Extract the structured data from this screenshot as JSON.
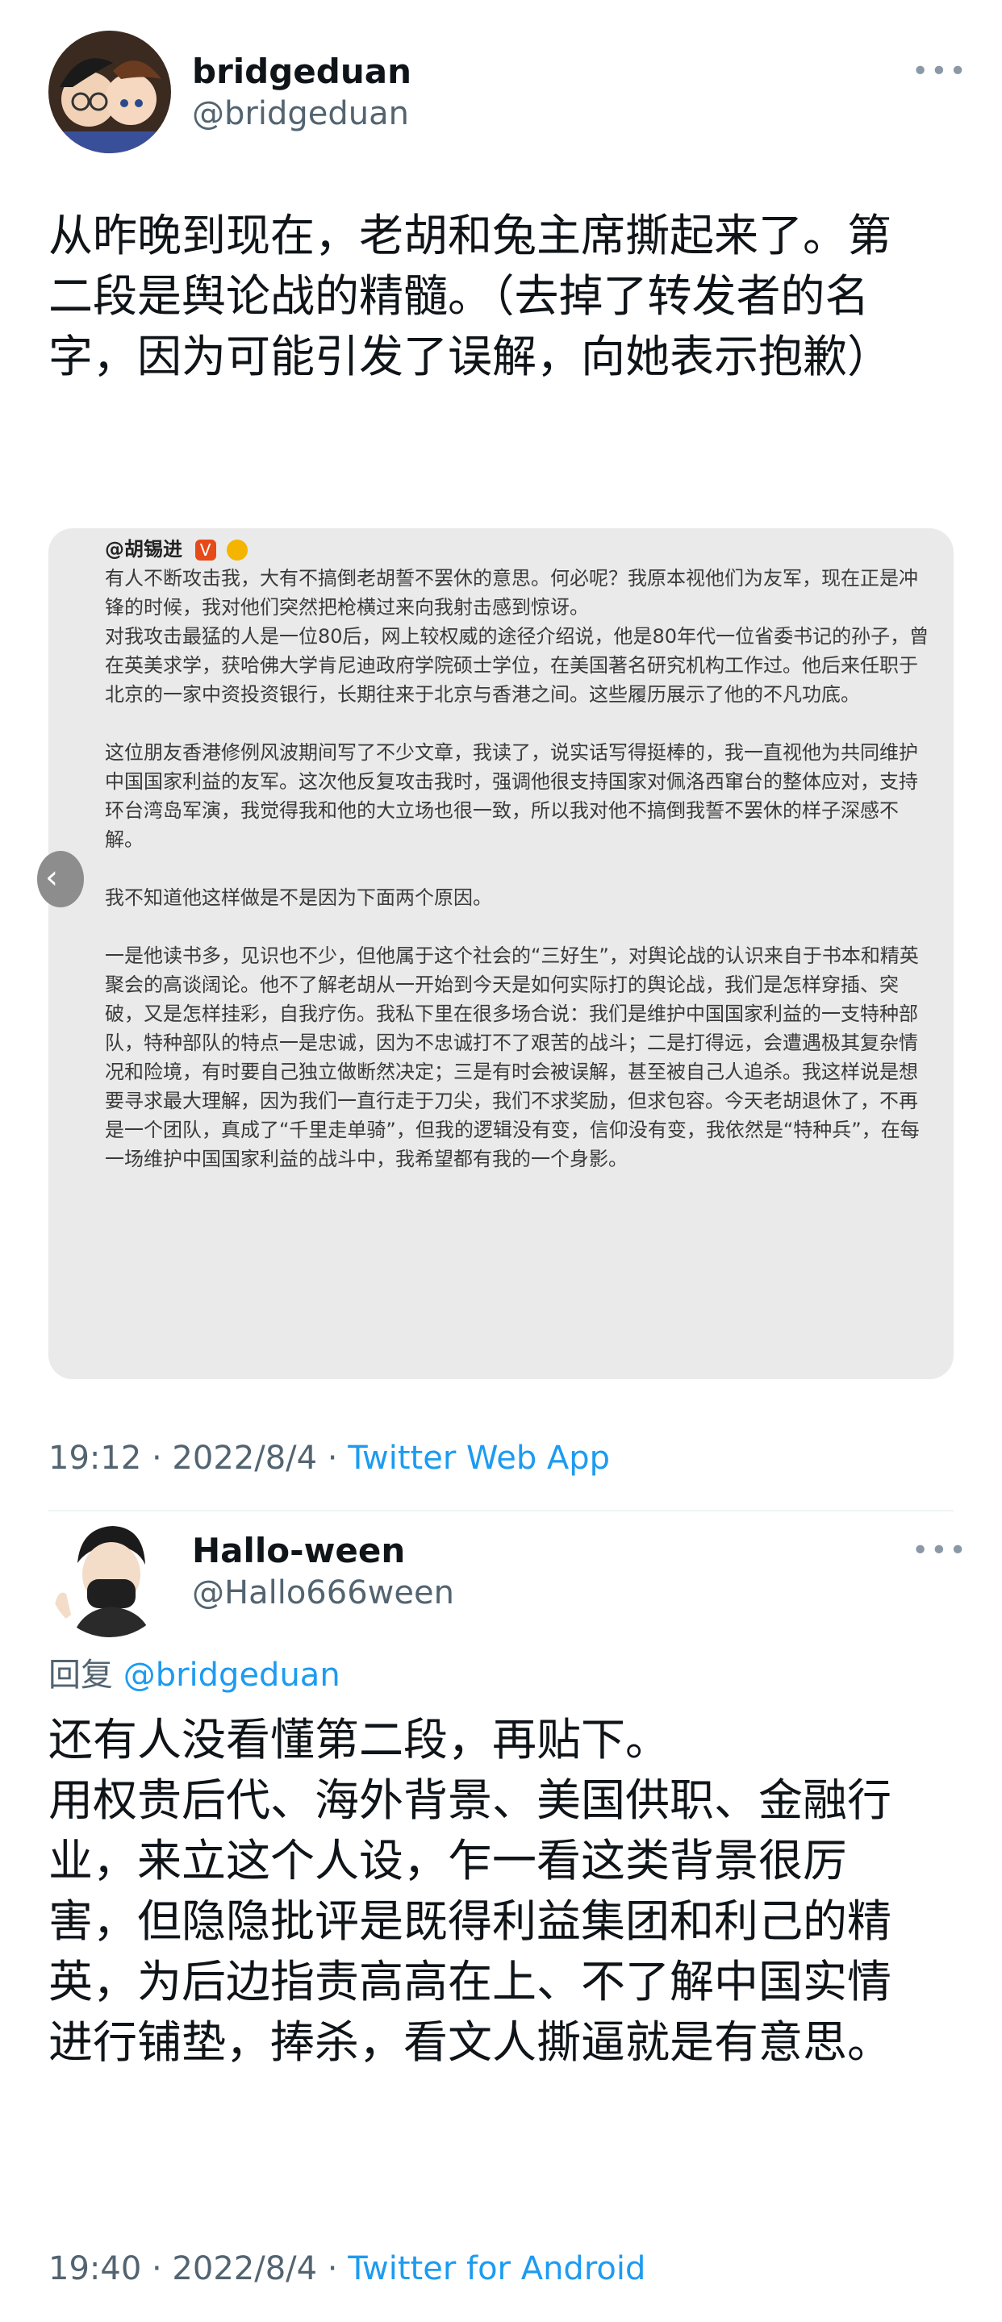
{
  "tweet1": {
    "author_name": "bridgeduan",
    "author_handle": "@bridgeduan",
    "more_icon": "more-horizontal-icon",
    "text": "从昨晚到现在，老胡和兔主席撕起来了。第二段是舆论战的精髓。（去掉了转发者的名字，因为可能引发了误解，向她表示抱歉）",
    "timestamp": "19:12 · 2022/8/4 · ",
    "source": "Twitter Web App",
    "embedded_image": {
      "header": "@胡锡进",
      "badge": "V",
      "paragraphs": [
        "有人不断攻击我，大有不搞倒老胡誓不罢休的意思。何必呢？我原本视他们为友军，现在正是冲锋的时候，我对他们突然把枪横过来向我射击感到惊讶。",
        "对我攻击最猛的人是一位80后，网上较权威的途径介绍说，他是80年代一位省委书记的孙子，曾在英美求学，获哈佛大学肯尼迪政府学院硕士学位，在美国著名研究机构工作过。他后来任职于北京的一家中资投资银行，长期往来于北京与香港之间。这些履历展示了他的不凡功底。",
        "这位朋友香港修例风波期间写了不少文章，我读了，说实话写得挺棒的，我一直视他为共同维护中国国家利益的友军。这次他反复攻击我时，强调他很支持国家对佩洛西窜台的整体应对，支持环台湾岛军演，我觉得我和他的大立场也很一致，所以我对他不搞倒我誓不罢休的样子深感不解。",
        "我不知道他这样做是不是因为下面两个原因。",
        "一是他读书多，见识也不少，但他属于这个社会的“三好生”，对舆论战的认识来自于书本和精英聚会的高谈阔论。他不了解老胡从一开始到今天是如何实际打的舆论战，我们是怎样穿插、突破，又是怎样挂彩，自我疗伤。我私下里在很多场合说：我们是维护中国国家利益的一支特种部队，特种部队的特点一是忠诚，因为不忠诚打不了艰苦的战斗；二是打得远，会遭遇极其复杂情况和险境，有时要自己独立做断然决定；三是有时会被误解，甚至被自己人追杀。我这样说是想要寻求最大理解，因为我们一直行走于刀尖，我们不求奖励，但求包容。今天老胡退休了，不再是一个团队，真成了“千里走单骑”，但我的逻辑没有变，信仰没有变，我依然是“特种兵”，在每一场维护中国国家利益的战斗中，我希望都有我的一个身影。"
      ]
    }
  },
  "tweet2": {
    "author_name": "Hallo-ween",
    "author_handle": "@Hallo666ween",
    "more_icon": "more-horizontal-icon",
    "reply_prefix": "回复 ",
    "reply_to": "@bridgeduan",
    "text": "还有人没看懂第二段，再贴下。\n用权贵后代、海外背景、美国供职、金融行业，来立这个人设，乍一看这类背景很厉害，但隐隐批评是既得利益集团和利己的精英，为后边指责高高在上、不了解中国实情进行铺垫，捧杀，看文人撕逼就是有意思。",
    "timestamp": "19:40 · 2022/8/4 · ",
    "source": "Twitter for Android"
  },
  "colors": {
    "link": "#1d9bf0",
    "secondary": "#536471",
    "text": "#0f1419"
  }
}
